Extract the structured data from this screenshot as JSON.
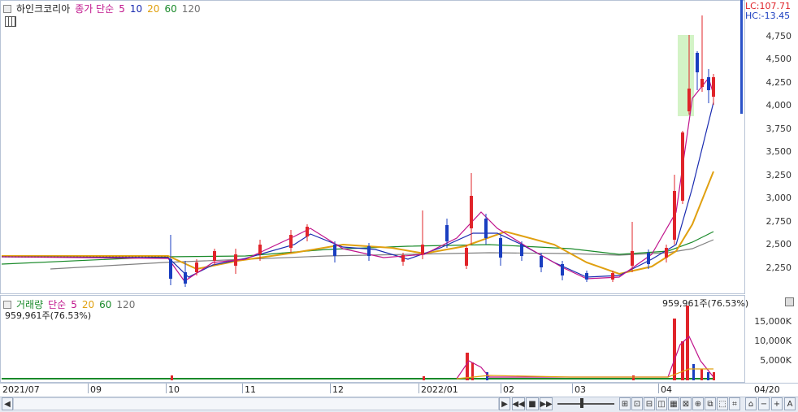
{
  "price_panel": {
    "stock_name": "하인크코리아",
    "ma_title": "종가 단순",
    "ma_periods": [
      "5",
      "10",
      "20",
      "60",
      "120"
    ],
    "ma_colors": [
      "#c0148c",
      "#1a2bb0",
      "#e0a010",
      "#1a8a2a",
      "#707070"
    ],
    "lc_label": "LC:107.71",
    "hc_label": "HC:-13.45",
    "y_ticks": [
      "4,750",
      "4,500",
      "4,250",
      "4,000",
      "3,750",
      "3,500",
      "3,250",
      "3,000",
      "2,750",
      "2,500",
      "2,250"
    ]
  },
  "volume_panel": {
    "title": "거래량",
    "ma_title": "단순",
    "ma_periods": [
      "5",
      "20",
      "60",
      "120"
    ],
    "ma_colors": [
      "#c0148c",
      "#e0a010",
      "#1a8a2a",
      "#707070"
    ],
    "last_volume": "959,961주(76.53%)",
    "y_ticks": [
      "15,000K",
      "10,000K",
      "5,000K"
    ]
  },
  "x_axis": {
    "labels": [
      "2021/07",
      "09",
      "10",
      "11",
      "12",
      "2022/01",
      "02",
      "03",
      "04"
    ],
    "end_label": "04/20"
  },
  "toolbar": {
    "scroll_left": "◀",
    "scroll_right": "▶",
    "rewind": "◀◀",
    "stop": "■",
    "fast_forward": "▶▶",
    "zoom_out": "−",
    "zoom_in": "+",
    "text_tool": "A"
  },
  "colors": {
    "up": "#e0242a",
    "down": "#1a3ec0",
    "highlight": "#c8f0b8",
    "panel_border": "#b8c4d6"
  },
  "chart_data": {
    "type": "candlestick",
    "title": "하인크코리아",
    "x_start": "2021/07",
    "x_end": "04/20",
    "ylim": [
      2000,
      5000
    ],
    "closes_by_segment": [
      {
        "period": "2021/07-09",
        "approx_close": 2380
      },
      {
        "period": "10",
        "approx_close": 2320
      },
      {
        "period": "11",
        "approx_close": 2600
      },
      {
        "period": "12",
        "approx_close": 2400
      },
      {
        "period": "2022/01",
        "approx_close": 2700
      },
      {
        "period": "02",
        "approx_close": 2500
      },
      {
        "period": "03",
        "approx_close": 2200
      },
      {
        "period": "04",
        "approx_close": 4100
      }
    ],
    "recent_high": 4950,
    "volume_ylim": [
      0,
      20000
    ],
    "volume_unit": "K"
  }
}
